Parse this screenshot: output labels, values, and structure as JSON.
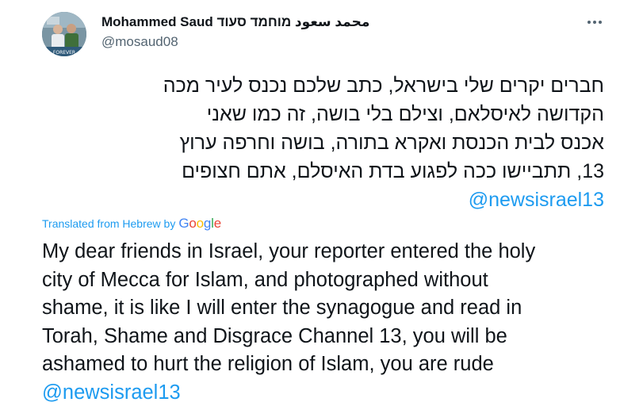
{
  "author": {
    "display_name": "Mohammed Saud محمد سعود מוחמד סעוד",
    "handle": "@mosaud08",
    "avatar_caption": "FOREVER"
  },
  "tweet": {
    "hebrew_lines": [
      "חברים יקרים שלי בישראל, כתב שלכם נכנס לעיר מכה",
      "הקדושה לאיסלאם, וצילם בלי בושה, זה כמו שאני",
      "אכנס לבית הכנסת ואקרא בתורה, בושה וחרפה ערוץ",
      "13, תתביישו ככה לפגוע בדת האיסלם, אתם חצופים"
    ],
    "mention": "@newsisrael13",
    "translated_label": "Translated from Hebrew by",
    "translation_provider": "Google",
    "english_lines": [
      "My dear friends in Israel, your reporter entered the holy",
      "city of Mecca for Islam, and photographed without",
      "shame, it is like I will enter the synagogue and read in",
      "Torah, Shame and Disgrace Channel 13, you will be",
      "ashamed to hurt the religion of Islam, you are rude"
    ]
  },
  "icons": {
    "more": "more-horizontal-icon"
  },
  "colors": {
    "accent": "#1d9bf0",
    "secondary_text": "#536471",
    "primary_text": "#0f1419"
  }
}
